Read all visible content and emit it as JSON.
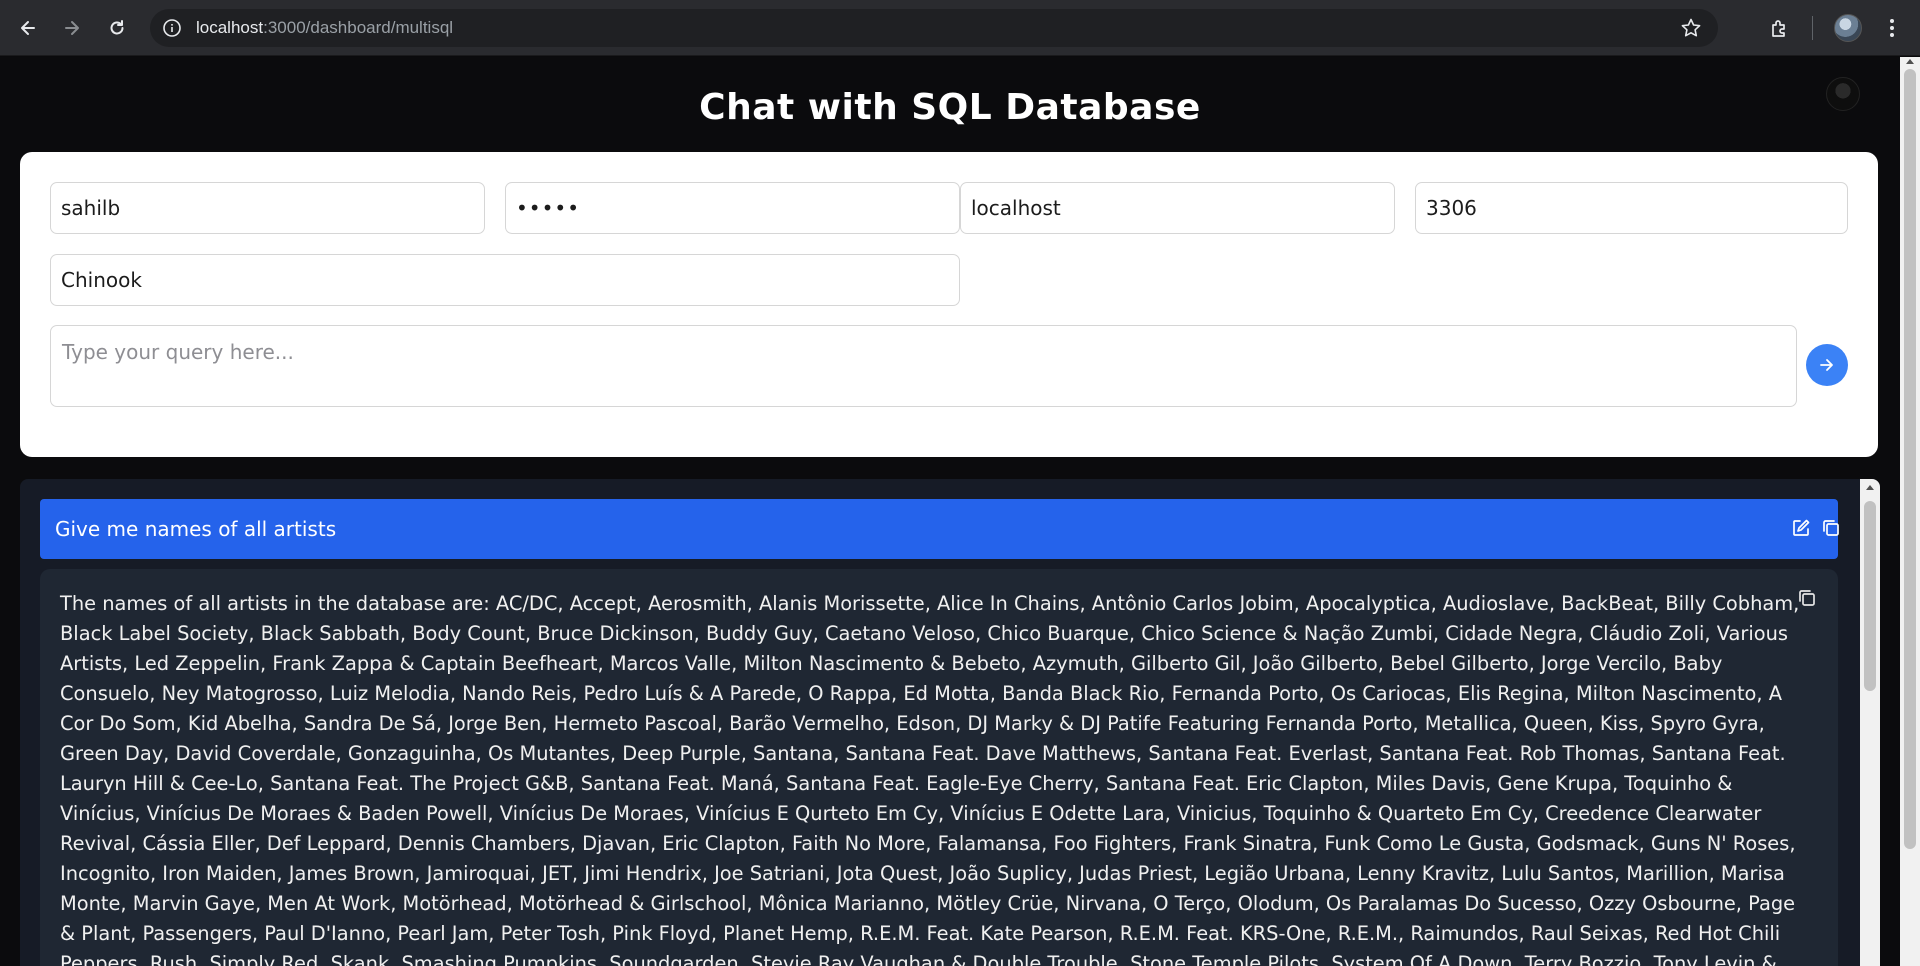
{
  "browser": {
    "url_host": "localhost",
    "url_rest": ":3000/dashboard/multisql"
  },
  "page": {
    "title": "Chat with SQL Database"
  },
  "form": {
    "username": "sahilb",
    "password": "•••••",
    "host": "localhost",
    "port": "3306",
    "database": "Chinook",
    "query_placeholder": "Type your query here..."
  },
  "chat": {
    "user_message": "Give me names of all artists",
    "bot_message": "The names of all artists in the database are: AC/DC, Accept, Aerosmith, Alanis Morissette, Alice In Chains, Antônio Carlos Jobim, Apocalyptica, Audioslave, BackBeat, Billy Cobham, Black Label Society, Black Sabbath, Body Count, Bruce Dickinson, Buddy Guy, Caetano Veloso, Chico Buarque, Chico Science & Nação Zumbi, Cidade Negra, Cláudio Zoli, Various Artists, Led Zeppelin, Frank Zappa & Captain Beefheart, Marcos Valle, Milton Nascimento & Bebeto, Azymuth, Gilberto Gil, João Gilberto, Bebel Gilberto, Jorge Vercilo, Baby Consuelo, Ney Matogrosso, Luiz Melodia, Nando Reis, Pedro Luís & A Parede, O Rappa, Ed Motta, Banda Black Rio, Fernanda Porto, Os Cariocas, Elis Regina, Milton Nascimento, A Cor Do Som, Kid Abelha, Sandra De Sá, Jorge Ben, Hermeto Pascoal, Barão Vermelho, Edson, DJ Marky & DJ Patife Featuring Fernanda Porto, Metallica, Queen, Kiss, Spyro Gyra, Green Day, David Coverdale, Gonzaguinha, Os Mutantes, Deep Purple, Santana, Santana Feat. Dave Matthews, Santana Feat. Everlast, Santana Feat. Rob Thomas, Santana Feat. Lauryn Hill & Cee-Lo, Santana Feat. The Project G&B, Santana Feat. Maná, Santana Feat. Eagle-Eye Cherry, Santana Feat. Eric Clapton, Miles Davis, Gene Krupa, Toquinho & Vinícius, Vinícius De Moraes & Baden Powell, Vinícius De Moraes, Vinícius E Qurteto Em Cy, Vinícius E Odette Lara, Vinicius, Toquinho & Quarteto Em Cy, Creedence Clearwater Revival, Cássia Eller, Def Leppard, Dennis Chambers, Djavan, Eric Clapton, Faith No More, Falamansa, Foo Fighters, Frank Sinatra, Funk Como Le Gusta, Godsmack, Guns N' Roses, Incognito, Iron Maiden, James Brown, Jamiroquai, JET, Jimi Hendrix, Joe Satriani, Jota Quest, João Suplicy, Judas Priest, Legião Urbana, Lenny Kravitz, Lulu Santos, Marillion, Marisa Monte, Marvin Gaye, Men At Work, Motörhead, Motörhead & Girlschool, Mônica Marianno, Mötley Crüe, Nirvana, O Terço, Olodum, Os Paralamas Do Sucesso, Ozzy Osbourne, Page & Plant, Passengers, Paul D'Ianno, Pearl Jam, Peter Tosh, Pink Floyd, Planet Hemp, R.E.M. Feat. Kate Pearson, R.E.M. Feat. KRS-One, R.E.M., Raimundos, Raul Seixas, Red Hot Chili Peppers, Rush, Simply Red, Skank, Smashing Pumpkins, Soundgarden, Stevie Ray Vaughan & Double Trouble, Stone Temple Pilots, System Of A Down, Terry Bozzio, Tony Levin & Steve Stevens, The Black Crowes, The Clash, The"
  },
  "colors": {
    "accent": "#3b82f6",
    "user_bubble": "#2563eb",
    "bot_bubble": "#1f2733",
    "chat_bg": "#161b26",
    "page_bg": "#0b0b0d"
  }
}
